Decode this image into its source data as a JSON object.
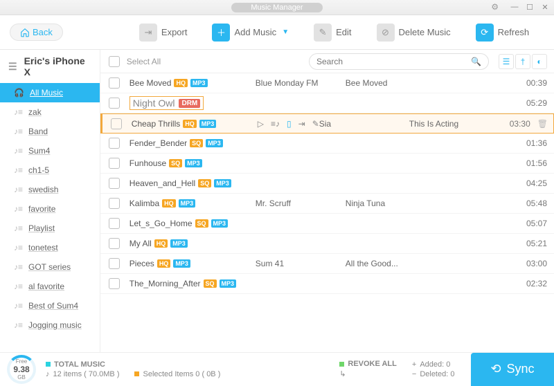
{
  "window": {
    "title": "Music Manager"
  },
  "toolbar": {
    "back": "Back",
    "export": "Export",
    "add_music": "Add Music",
    "edit": "Edit",
    "delete_music": "Delete Music",
    "refresh": "Refresh"
  },
  "device": {
    "name": "Eric's iPhone X"
  },
  "sidebar": [
    {
      "label": "All Music",
      "active": true
    },
    {
      "label": "zak"
    },
    {
      "label": "Band"
    },
    {
      "label": "Sum4"
    },
    {
      "label": "ch1-5"
    },
    {
      "label": "swedish"
    },
    {
      "label": "favorite"
    },
    {
      "label": "Playlist"
    },
    {
      "label": "tonetest"
    },
    {
      "label": "GOT series"
    },
    {
      "label": "al favorite"
    },
    {
      "label": "Best of Sum4"
    },
    {
      "label": "Jogging music"
    }
  ],
  "listhead": {
    "select_all": "Select All",
    "search_placeholder": "Search"
  },
  "tracks": [
    {
      "title": "Bee Moved",
      "q": "HQ",
      "fmt": "MP3",
      "artist": "Blue Monday FM",
      "album": "Bee Moved",
      "dur": "00:39"
    },
    {
      "title": "Night Owl",
      "drm": "DRM",
      "dur": "05:29",
      "boxed": true
    },
    {
      "title": "Cheap Thrills",
      "q": "HQ",
      "fmt": "MP3",
      "artist": "Sia",
      "album": "This Is Acting",
      "dur": "03:30",
      "hover": true
    },
    {
      "title": "Fender_Bender",
      "q": "SQ",
      "fmt": "MP3",
      "dur": "01:36"
    },
    {
      "title": "Funhouse",
      "q": "SQ",
      "fmt": "MP3",
      "dur": "01:56"
    },
    {
      "title": "Heaven_and_Hell",
      "q": "SQ",
      "fmt": "MP3",
      "dur": "04:25"
    },
    {
      "title": "Kalimba",
      "q": "HQ",
      "fmt": "MP3",
      "artist": "Mr. Scruff",
      "album": "Ninja Tuna",
      "dur": "05:48"
    },
    {
      "title": "Let_s_Go_Home",
      "q": "SQ",
      "fmt": "MP3",
      "dur": "05:07"
    },
    {
      "title": "My All",
      "q": "HQ",
      "fmt": "MP3",
      "dur": "05:21"
    },
    {
      "title": "Pieces",
      "q": "HQ",
      "fmt": "MP3",
      "artist": "Sum 41",
      "album": "All the Good...",
      "dur": "03:00"
    },
    {
      "title": "The_Morning_After",
      "q": "SQ",
      "fmt": "MP3",
      "dur": "02:32"
    }
  ],
  "footer": {
    "free_label": "Free",
    "free_value": "9.38",
    "free_unit": "GB",
    "total_label": "TOTAL MUSIC",
    "items_line": "12 items ( 70.0MB )",
    "selected_line": "Selected Items 0 ( 0B )",
    "revoke": "REVOKE ALL",
    "added": "Added: 0",
    "deleted": "Deleted: 0",
    "sync": "Sync"
  }
}
